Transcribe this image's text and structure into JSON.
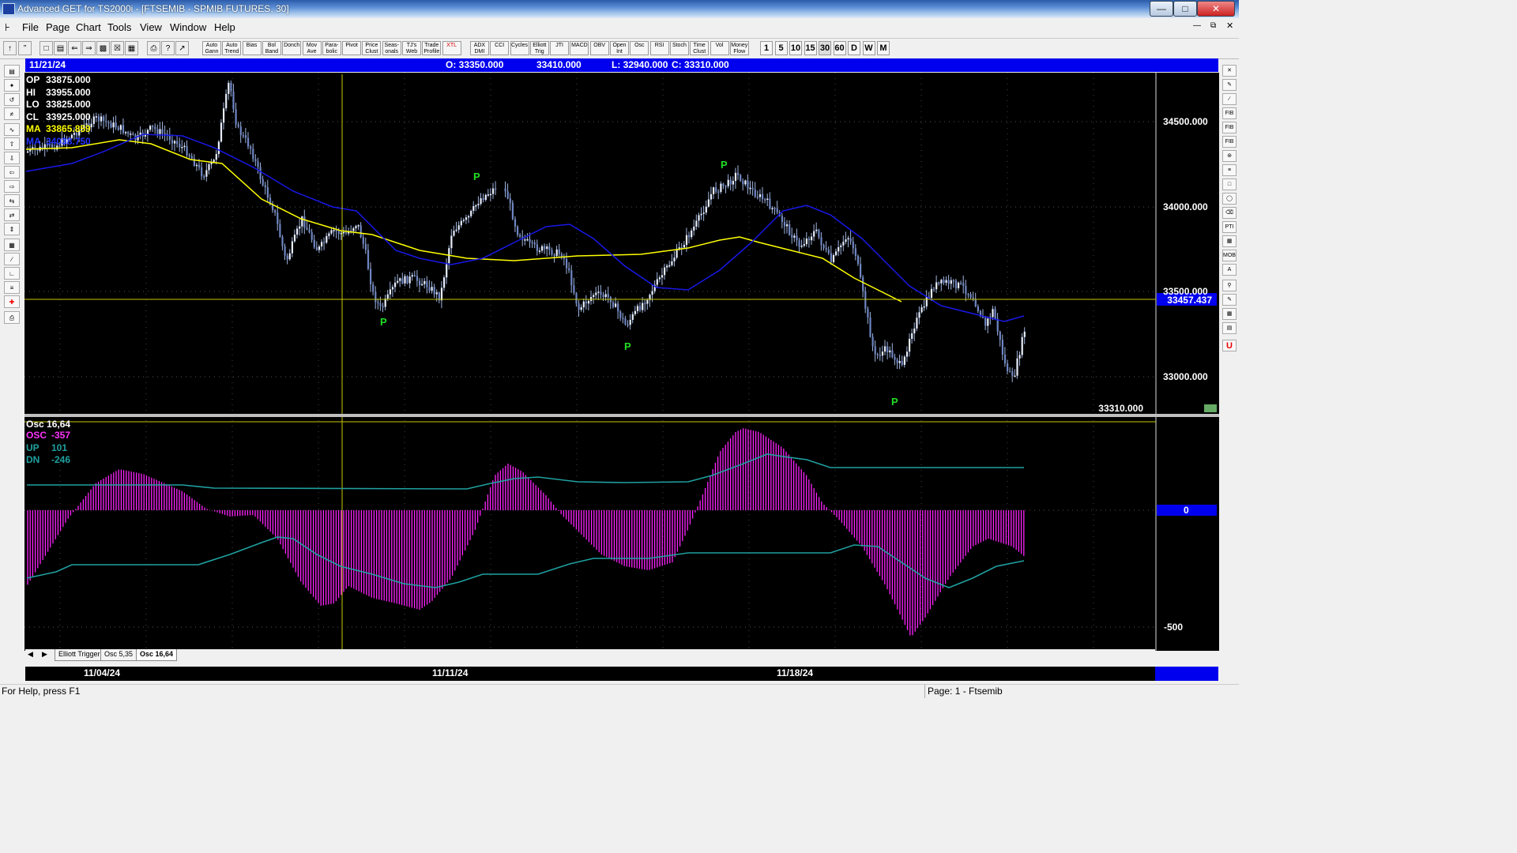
{
  "window": {
    "title": "Advanced GET for TS2000i - [FTSEMIB - SPMIB FUTURES, 30]"
  },
  "menu": [
    "File",
    "Page",
    "Chart",
    "Tools",
    "View",
    "Window",
    "Help"
  ],
  "toolbar": {
    "studies": [
      {
        "l1": "Auto",
        "l2": "Gann"
      },
      {
        "l1": "Auto",
        "l2": "Trend"
      },
      {
        "l1": "Bias",
        "l2": ""
      },
      {
        "l1": "Bol",
        "l2": "Band"
      },
      {
        "l1": "Donch",
        "l2": ""
      },
      {
        "l1": "Mov",
        "l2": "Ave"
      },
      {
        "l1": "Para-",
        "l2": "bolic"
      },
      {
        "l1": "Pivot",
        "l2": ""
      },
      {
        "l1": "Price",
        "l2": "Clust"
      },
      {
        "l1": "Seas-",
        "l2": "onals"
      },
      {
        "l1": "TJ's",
        "l2": "Web"
      },
      {
        "l1": "Trade",
        "l2": "Profile"
      },
      {
        "l1": "XTL",
        "l2": ""
      },
      {
        "l1": "ADX",
        "l2": "DMI"
      },
      {
        "l1": "CCI",
        "l2": ""
      },
      {
        "l1": "Cycles",
        "l2": ""
      },
      {
        "l1": "Elliott",
        "l2": "Trig"
      },
      {
        "l1": "JTI",
        "l2": ""
      },
      {
        "l1": "MACD",
        "l2": ""
      },
      {
        "l1": "OBV",
        "l2": ""
      },
      {
        "l1": "Open",
        "l2": "Int"
      },
      {
        "l1": "Osc",
        "l2": ""
      },
      {
        "l1": "RSI",
        "l2": ""
      },
      {
        "l1": "Stoch",
        "l2": ""
      },
      {
        "l1": "Time",
        "l2": "Clust"
      },
      {
        "l1": "Vol",
        "l2": ""
      },
      {
        "l1": "Money",
        "l2": "Flow"
      }
    ],
    "intervals": [
      "1",
      "5",
      "10",
      "15",
      "30",
      "60",
      "D",
      "W",
      "M"
    ]
  },
  "infobar": {
    "date": "11/21/24",
    "open": "O: 33350.000",
    "high": "33410.000",
    "low": "L: 32940.000",
    "close": "C: 33310.000"
  },
  "price_panel": {
    "legend": [
      {
        "label": "OP",
        "value": "33875.000",
        "color": "#ffffff"
      },
      {
        "label": "HI",
        "value": "33955.000",
        "color": "#ffffff"
      },
      {
        "label": "LO",
        "value": "33825.000",
        "color": "#ffffff"
      },
      {
        "label": "CL",
        "value": "33925.000",
        "color": "#ffffff"
      },
      {
        "label": "MA",
        "value": "33865.859",
        "color": "#ffff00"
      },
      {
        "label": "MA",
        "value": "34038.750",
        "color": "#2233ff"
      }
    ],
    "axis_labels": [
      "34500.000",
      "34000.000",
      "33500.000",
      "33000.000"
    ],
    "cursor_price": "33457.437",
    "last_price": "33310.000",
    "pivot_marker": "P"
  },
  "osc_panel": {
    "title": "Osc 16,64",
    "legend": [
      {
        "label": "OSC",
        "value": "-357",
        "color": "#ff33ff"
      },
      {
        "label": "UP",
        "value": "101",
        "color": "#20a0a0"
      },
      {
        "label": "DN",
        "value": "-246",
        "color": "#20a0a0"
      }
    ],
    "axis_labels": [
      "0",
      "-500"
    ]
  },
  "tabs": [
    "Elliott Trigger",
    "Osc 5,35",
    "Osc 16,64"
  ],
  "dates": [
    "11/04/24",
    "11/11/24",
    "11/18/24"
  ],
  "status": {
    "help": "For Help, press F1",
    "page": "Page: 1 - Ftsemib"
  }
}
